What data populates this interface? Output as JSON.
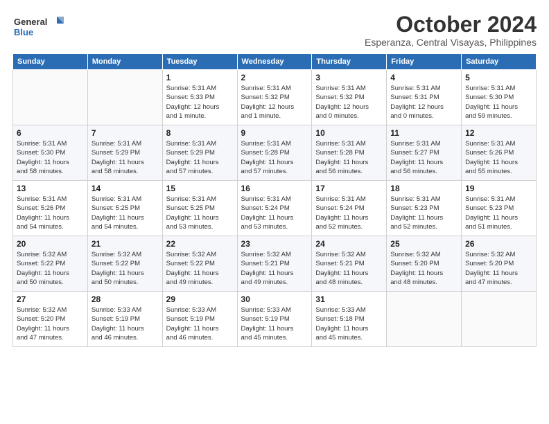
{
  "header": {
    "logo_general": "General",
    "logo_blue": "Blue",
    "month": "October 2024",
    "location": "Esperanza, Central Visayas, Philippines"
  },
  "days_of_week": [
    "Sunday",
    "Monday",
    "Tuesday",
    "Wednesday",
    "Thursday",
    "Friday",
    "Saturday"
  ],
  "weeks": [
    [
      {
        "day": "",
        "info": ""
      },
      {
        "day": "",
        "info": ""
      },
      {
        "day": "1",
        "info": "Sunrise: 5:31 AM\nSunset: 5:33 PM\nDaylight: 12 hours\nand 1 minute."
      },
      {
        "day": "2",
        "info": "Sunrise: 5:31 AM\nSunset: 5:32 PM\nDaylight: 12 hours\nand 1 minute."
      },
      {
        "day": "3",
        "info": "Sunrise: 5:31 AM\nSunset: 5:32 PM\nDaylight: 12 hours\nand 0 minutes."
      },
      {
        "day": "4",
        "info": "Sunrise: 5:31 AM\nSunset: 5:31 PM\nDaylight: 12 hours\nand 0 minutes."
      },
      {
        "day": "5",
        "info": "Sunrise: 5:31 AM\nSunset: 5:30 PM\nDaylight: 11 hours\nand 59 minutes."
      }
    ],
    [
      {
        "day": "6",
        "info": "Sunrise: 5:31 AM\nSunset: 5:30 PM\nDaylight: 11 hours\nand 58 minutes."
      },
      {
        "day": "7",
        "info": "Sunrise: 5:31 AM\nSunset: 5:29 PM\nDaylight: 11 hours\nand 58 minutes."
      },
      {
        "day": "8",
        "info": "Sunrise: 5:31 AM\nSunset: 5:29 PM\nDaylight: 11 hours\nand 57 minutes."
      },
      {
        "day": "9",
        "info": "Sunrise: 5:31 AM\nSunset: 5:28 PM\nDaylight: 11 hours\nand 57 minutes."
      },
      {
        "day": "10",
        "info": "Sunrise: 5:31 AM\nSunset: 5:28 PM\nDaylight: 11 hours\nand 56 minutes."
      },
      {
        "day": "11",
        "info": "Sunrise: 5:31 AM\nSunset: 5:27 PM\nDaylight: 11 hours\nand 56 minutes."
      },
      {
        "day": "12",
        "info": "Sunrise: 5:31 AM\nSunset: 5:26 PM\nDaylight: 11 hours\nand 55 minutes."
      }
    ],
    [
      {
        "day": "13",
        "info": "Sunrise: 5:31 AM\nSunset: 5:26 PM\nDaylight: 11 hours\nand 54 minutes."
      },
      {
        "day": "14",
        "info": "Sunrise: 5:31 AM\nSunset: 5:25 PM\nDaylight: 11 hours\nand 54 minutes."
      },
      {
        "day": "15",
        "info": "Sunrise: 5:31 AM\nSunset: 5:25 PM\nDaylight: 11 hours\nand 53 minutes."
      },
      {
        "day": "16",
        "info": "Sunrise: 5:31 AM\nSunset: 5:24 PM\nDaylight: 11 hours\nand 53 minutes."
      },
      {
        "day": "17",
        "info": "Sunrise: 5:31 AM\nSunset: 5:24 PM\nDaylight: 11 hours\nand 52 minutes."
      },
      {
        "day": "18",
        "info": "Sunrise: 5:31 AM\nSunset: 5:23 PM\nDaylight: 11 hours\nand 52 minutes."
      },
      {
        "day": "19",
        "info": "Sunrise: 5:31 AM\nSunset: 5:23 PM\nDaylight: 11 hours\nand 51 minutes."
      }
    ],
    [
      {
        "day": "20",
        "info": "Sunrise: 5:32 AM\nSunset: 5:22 PM\nDaylight: 11 hours\nand 50 minutes."
      },
      {
        "day": "21",
        "info": "Sunrise: 5:32 AM\nSunset: 5:22 PM\nDaylight: 11 hours\nand 50 minutes."
      },
      {
        "day": "22",
        "info": "Sunrise: 5:32 AM\nSunset: 5:22 PM\nDaylight: 11 hours\nand 49 minutes."
      },
      {
        "day": "23",
        "info": "Sunrise: 5:32 AM\nSunset: 5:21 PM\nDaylight: 11 hours\nand 49 minutes."
      },
      {
        "day": "24",
        "info": "Sunrise: 5:32 AM\nSunset: 5:21 PM\nDaylight: 11 hours\nand 48 minutes."
      },
      {
        "day": "25",
        "info": "Sunrise: 5:32 AM\nSunset: 5:20 PM\nDaylight: 11 hours\nand 48 minutes."
      },
      {
        "day": "26",
        "info": "Sunrise: 5:32 AM\nSunset: 5:20 PM\nDaylight: 11 hours\nand 47 minutes."
      }
    ],
    [
      {
        "day": "27",
        "info": "Sunrise: 5:32 AM\nSunset: 5:20 PM\nDaylight: 11 hours\nand 47 minutes."
      },
      {
        "day": "28",
        "info": "Sunrise: 5:33 AM\nSunset: 5:19 PM\nDaylight: 11 hours\nand 46 minutes."
      },
      {
        "day": "29",
        "info": "Sunrise: 5:33 AM\nSunset: 5:19 PM\nDaylight: 11 hours\nand 46 minutes."
      },
      {
        "day": "30",
        "info": "Sunrise: 5:33 AM\nSunset: 5:19 PM\nDaylight: 11 hours\nand 45 minutes."
      },
      {
        "day": "31",
        "info": "Sunrise: 5:33 AM\nSunset: 5:18 PM\nDaylight: 11 hours\nand 45 minutes."
      },
      {
        "day": "",
        "info": ""
      },
      {
        "day": "",
        "info": ""
      }
    ]
  ]
}
